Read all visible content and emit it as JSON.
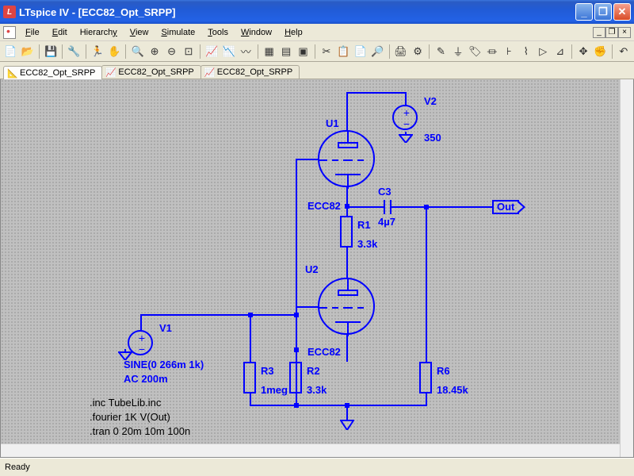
{
  "titlebar": {
    "text": "LTspice IV - [ECC82_Opt_SRPP]"
  },
  "menu": {
    "file": "File",
    "edit": "Edit",
    "hierarchy": "Hierarchy",
    "view": "View",
    "simulate": "Simulate",
    "tools": "Tools",
    "window": "Window",
    "help": "Help"
  },
  "tabs": {
    "t1": "ECC82_Opt_SRPP",
    "t2": "ECC82_Opt_SRPP",
    "t3": "ECC82_Opt_SRPP"
  },
  "schematic": {
    "components": {
      "V2": {
        "ref": "V2",
        "value": "350"
      },
      "U1": {
        "ref": "U1",
        "model": "ECC82"
      },
      "U2": {
        "ref": "U2",
        "model": "ECC82"
      },
      "R1": {
        "ref": "R1",
        "value": "3.3k"
      },
      "R2": {
        "ref": "R2",
        "value": "3.3k"
      },
      "R3": {
        "ref": "R3",
        "value": "1meg"
      },
      "R6": {
        "ref": "R6",
        "value": "18.45k"
      },
      "C3": {
        "ref": "C3",
        "value": "4µ7"
      },
      "V1": {
        "ref": "V1",
        "value1": "SINE(0 266m 1k)",
        "value2": "AC 200m"
      }
    },
    "netlabel": {
      "out": "Out"
    },
    "directives": {
      "d1": ".inc TubeLib.inc",
      "d2": ".fourier 1K V(Out)",
      "d3": ".tran 0 20m 10m 100n"
    }
  },
  "status": {
    "text": "Ready"
  },
  "colors": {
    "wire": "#0000ff",
    "text": "#0000ff"
  }
}
